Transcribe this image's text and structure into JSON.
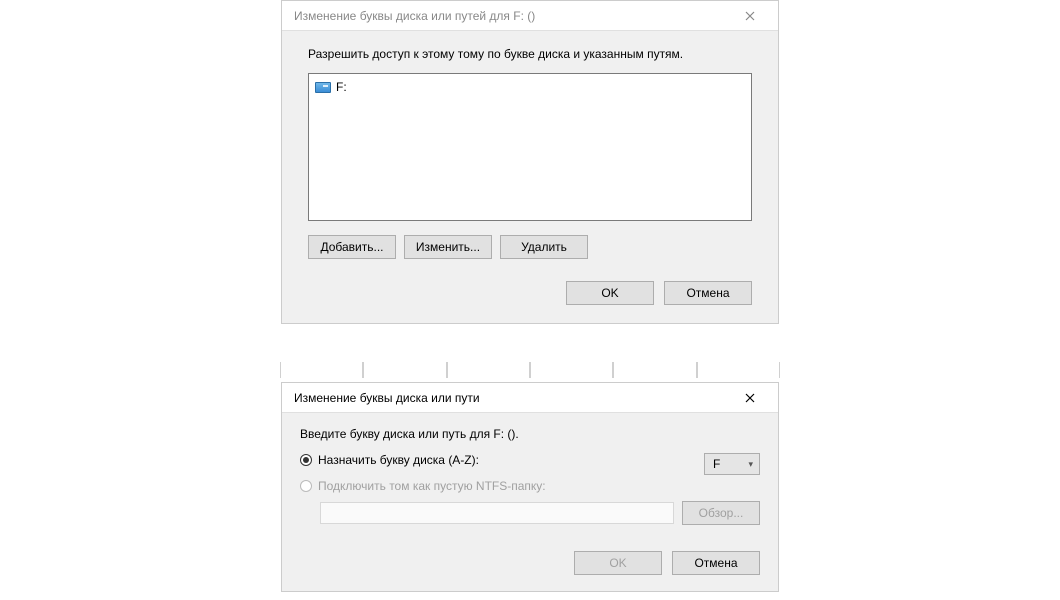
{
  "dialog1": {
    "title": "Изменение буквы диска или путей для F: ()",
    "instruction": "Разрешить доступ к этому тому по букве диска и указанным путям.",
    "list_item": "F:",
    "add": "Добавить...",
    "change": "Изменить...",
    "delete": "Удалить",
    "ok": "OK",
    "cancel": "Отмена"
  },
  "dialog2": {
    "title": "Изменение буквы диска или пути",
    "instruction": "Введите букву диска или путь для F: ().",
    "assign_label": "Назначить букву диска (A-Z):",
    "drive_letter": "F",
    "mount_label": "Подключить том как пустую NTFS-папку:",
    "browse": "Обзор...",
    "ok": "OK",
    "cancel": "Отмена"
  }
}
